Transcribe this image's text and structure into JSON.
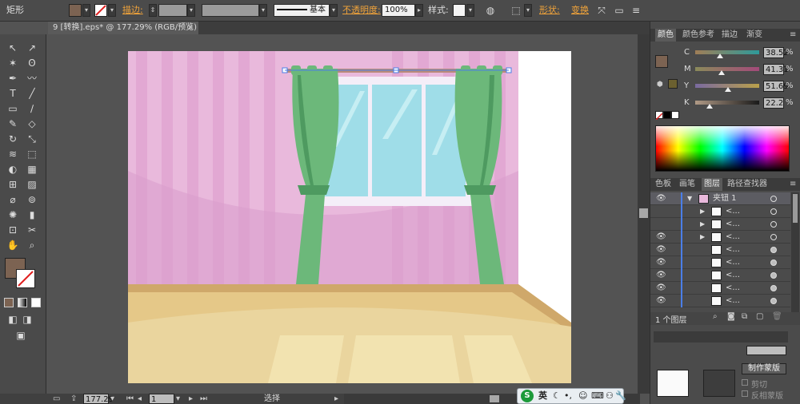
{
  "control_bar": {
    "object_type": "矩形",
    "stroke_label": "描边:",
    "stroke_profile": "基本",
    "opacity_label": "不透明度:",
    "opacity_value": "100%",
    "style_label": "样式:",
    "shape_label": "形状:",
    "transform_label": "变换"
  },
  "document_tab": {
    "title": "9 [转换].eps* @ 177.29% (RGB/预览)",
    "close_symbol": "×"
  },
  "toolbox": {
    "fill_color": "#7c6352",
    "tools": [
      "selection-tool",
      "direct-selection-tool",
      "magic-wand-tool",
      "lasso-tool",
      "pen-tool",
      "curvature-tool",
      "type-tool",
      "line-tool",
      "rectangle-tool",
      "paintbrush-tool",
      "pencil-tool",
      "eraser-tool",
      "rotate-tool",
      "scale-tool",
      "width-tool",
      "free-transform-tool",
      "shape-builder-tool",
      "chart-tool",
      "mesh-tool",
      "gradient-tool",
      "eyedropper-tool",
      "blend-tool",
      "symbol-sprayer-tool",
      "column-graph-tool",
      "artboard-tool",
      "slice-tool",
      "hand-tool",
      "zoom-tool"
    ]
  },
  "color_panel": {
    "tabs": [
      "颜色",
      "颜色参考",
      "描边",
      "渐变"
    ],
    "active_tab": "颜色",
    "fill_swatch": "#7c6352",
    "stroke_swatch": "#6b6030",
    "channels": [
      {
        "label": "C",
        "value": "38.52",
        "fraction": 0.3852
      },
      {
        "label": "M",
        "value": "41.31",
        "fraction": 0.4131
      },
      {
        "label": "Y",
        "value": "51.69",
        "fraction": 0.5169
      },
      {
        "label": "K",
        "value": "22.2",
        "fraction": 0.222
      }
    ],
    "unit": "%"
  },
  "layers_panel": {
    "tabs": [
      "色板",
      "画笔",
      "图层",
      "路径查找器"
    ],
    "active_tab": "图层",
    "top_layer_name": "夹钮 1",
    "sublayer_placeholder": "<...",
    "layer_count": "1 个图层"
  },
  "transparency_panel": {
    "label_mask": "制作蒙版",
    "clip_label": "剪切",
    "invert_label": "反相蒙版"
  },
  "status_bar": {
    "zoom": "177.29",
    "artboard": "1",
    "tool": "选择"
  },
  "ime": {
    "logo": "S",
    "lang": "英"
  },
  "scene": {
    "wall_color": "#e9b9dc",
    "floor_color": "#e5c888",
    "curtain_color": "#6cb87a",
    "glass_color": "#9fdde8"
  }
}
